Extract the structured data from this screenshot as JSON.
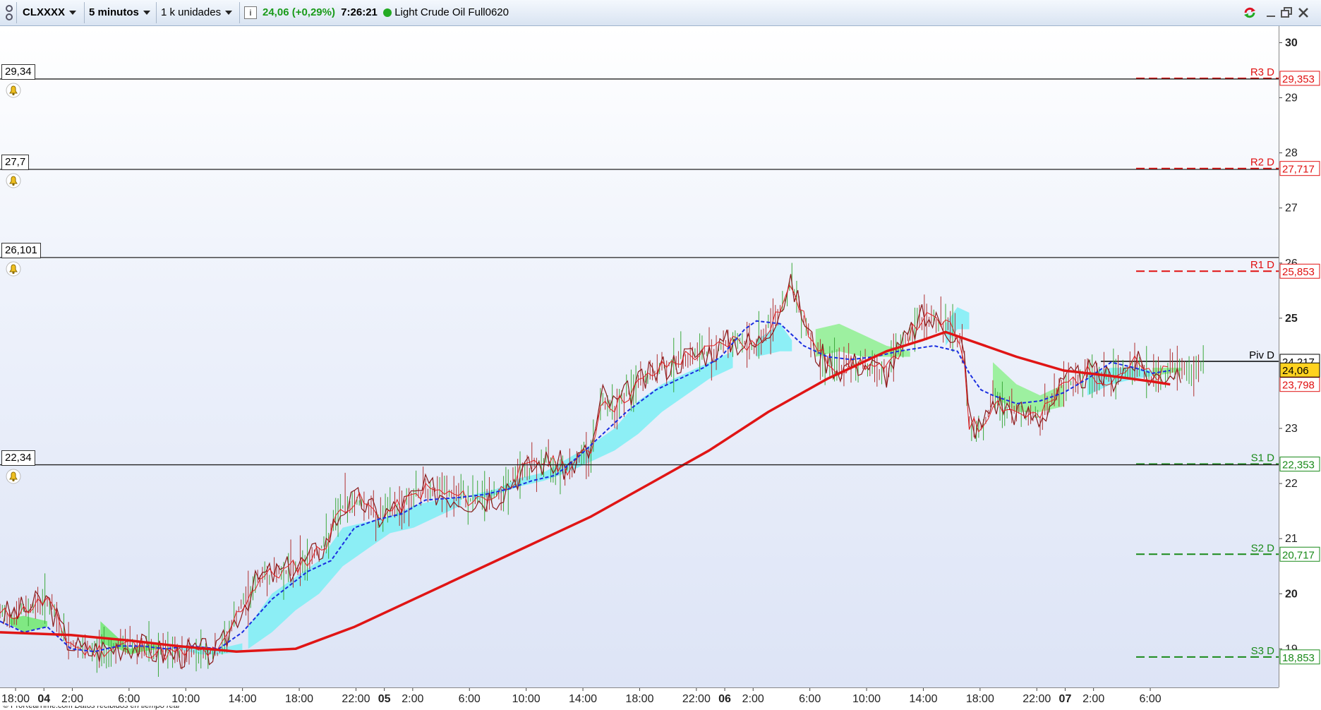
{
  "toolbar": {
    "symbol": "CLXXXX",
    "timeframe": "5 minutos",
    "units": "1 k unidades",
    "info_icon": "info-icon",
    "price": "24,06 (+0,29%)",
    "time": "7:26:21",
    "instrument": "Light Crude Oil Full0620",
    "colors": {
      "positive": "#1a9b1a",
      "status_dot": "#22aa22"
    }
  },
  "window_controls": [
    "refresh-icon",
    "minimize-icon",
    "restore-icon",
    "close-icon"
  ],
  "alerts": [
    {
      "label": "29,34",
      "value": 29.34
    },
    {
      "label": "27,7",
      "value": 27.7
    },
    {
      "label": "26,101",
      "value": 26.101
    },
    {
      "label": "22,34",
      "value": 22.34
    }
  ],
  "pivots": [
    {
      "name": "R3 D",
      "value": 29.353,
      "label": "29,353",
      "color": "#e01010"
    },
    {
      "name": "R2 D",
      "value": 27.717,
      "label": "27,717",
      "color": "#e01010"
    },
    {
      "name": "R1 D",
      "value": 25.853,
      "label": "25,853",
      "color": "#e01010"
    },
    {
      "name": "Piv D",
      "value": 24.217,
      "label": "24,217",
      "color": "#000000"
    },
    {
      "name": "S1 D",
      "value": 22.353,
      "label": "22,353",
      "color": "#1a8a1a"
    },
    {
      "name": "S2 D",
      "value": 20.717,
      "label": "20,717",
      "color": "#1a8a1a"
    },
    {
      "name": "S3 D",
      "value": 18.853,
      "label": "18,853",
      "color": "#1a8a1a"
    }
  ],
  "current_price": {
    "label": "24,06",
    "value": 24.06,
    "color": "#ffd21f"
  },
  "ma_price": {
    "label": "23,798",
    "value": 23.798,
    "color": "#e01010"
  },
  "credit": {
    "source": "© ProRealTime.com",
    "note": "Datos recibidos en tiempo real"
  },
  "chart_data": {
    "type": "line",
    "ylim": [
      18.3,
      30.3
    ],
    "y_ticks": [
      {
        "v": 30,
        "label": "30",
        "bold": true
      },
      {
        "v": 29,
        "label": "29"
      },
      {
        "v": 28,
        "label": "28"
      },
      {
        "v": 27,
        "label": "27"
      },
      {
        "v": 26,
        "label": "26"
      },
      {
        "v": 25,
        "label": "25",
        "bold": true
      },
      {
        "v": 23,
        "label": "23"
      },
      {
        "v": 22,
        "label": "22"
      },
      {
        "v": 21,
        "label": "21"
      },
      {
        "v": 20,
        "label": "20",
        "bold": true
      },
      {
        "v": 19,
        "label": "19"
      }
    ],
    "x_ticks": [
      {
        "i": 6,
        "label": "18:00"
      },
      {
        "i": 30,
        "label": "04",
        "bold": true
      },
      {
        "i": 54,
        "label": "2:00"
      },
      {
        "i": 102,
        "label": "6:00"
      },
      {
        "i": 150,
        "label": "10:00"
      },
      {
        "i": 198,
        "label": "14:00"
      },
      {
        "i": 246,
        "label": "18:00"
      },
      {
        "i": 294,
        "label": "22:00"
      },
      {
        "i": 318,
        "label": "05",
        "bold": true
      },
      {
        "i": 342,
        "label": "2:00"
      },
      {
        "i": 390,
        "label": "6:00"
      },
      {
        "i": 438,
        "label": "10:00"
      },
      {
        "i": 486,
        "label": "14:00"
      },
      {
        "i": 534,
        "label": "18:00"
      },
      {
        "i": 582,
        "label": "22:00"
      },
      {
        "i": 606,
        "label": "06",
        "bold": true
      },
      {
        "i": 630,
        "label": "2:00"
      },
      {
        "i": 678,
        "label": "6:00"
      },
      {
        "i": 726,
        "label": "10:00"
      },
      {
        "i": 774,
        "label": "14:00"
      },
      {
        "i": 822,
        "label": "18:00"
      },
      {
        "i": 870,
        "label": "22:00"
      },
      {
        "i": 894,
        "label": "07",
        "bold": true
      },
      {
        "i": 918,
        "label": "2:00"
      },
      {
        "i": 966,
        "label": "6:00"
      }
    ],
    "bars_count": 1020,
    "price_keypoints": [
      [
        0,
        19.6
      ],
      [
        20,
        19.7
      ],
      [
        40,
        19.9
      ],
      [
        55,
        19.2
      ],
      [
        70,
        18.95
      ],
      [
        90,
        19.0
      ],
      [
        110,
        19.1
      ],
      [
        130,
        18.95
      ],
      [
        150,
        18.9
      ],
      [
        170,
        18.95
      ],
      [
        185,
        18.9
      ],
      [
        200,
        19.6
      ],
      [
        220,
        20.3
      ],
      [
        240,
        20.4
      ],
      [
        260,
        20.6
      ],
      [
        275,
        20.9
      ],
      [
        290,
        21.6
      ],
      [
        305,
        21.7
      ],
      [
        320,
        21.4
      ],
      [
        340,
        21.6
      ],
      [
        360,
        21.9
      ],
      [
        380,
        21.8
      ],
      [
        400,
        21.7
      ],
      [
        420,
        21.8
      ],
      [
        440,
        22.2
      ],
      [
        460,
        22.4
      ],
      [
        480,
        22.3
      ],
      [
        500,
        22.6
      ],
      [
        510,
        23.6
      ],
      [
        520,
        23.4
      ],
      [
        540,
        23.8
      ],
      [
        560,
        24.1
      ],
      [
        580,
        24.3
      ],
      [
        600,
        24.4
      ],
      [
        620,
        24.6
      ],
      [
        640,
        24.5
      ],
      [
        660,
        25.2
      ],
      [
        670,
        25.6
      ],
      [
        690,
        24.4
      ],
      [
        710,
        24.1
      ],
      [
        730,
        24.2
      ],
      [
        750,
        24.0
      ],
      [
        760,
        24.4
      ],
      [
        780,
        25.0
      ],
      [
        800,
        24.9
      ],
      [
        815,
        24.5
      ],
      [
        820,
        23.1
      ],
      [
        830,
        23.0
      ],
      [
        840,
        23.5
      ],
      [
        860,
        23.3
      ],
      [
        880,
        23.2
      ],
      [
        900,
        23.8
      ],
      [
        920,
        24.0
      ],
      [
        940,
        23.9
      ],
      [
        960,
        24.2
      ],
      [
        975,
        23.9
      ],
      [
        990,
        24.06
      ]
    ],
    "ma_keypoints": [
      [
        0,
        19.3
      ],
      [
        60,
        19.25
      ],
      [
        110,
        19.15
      ],
      [
        150,
        19.05
      ],
      [
        200,
        18.95
      ],
      [
        250,
        19.0
      ],
      [
        300,
        19.4
      ],
      [
        350,
        19.9
      ],
      [
        400,
        20.4
      ],
      [
        450,
        20.9
      ],
      [
        500,
        21.4
      ],
      [
        550,
        22.0
      ],
      [
        600,
        22.6
      ],
      [
        650,
        23.3
      ],
      [
        700,
        23.9
      ],
      [
        750,
        24.4
      ],
      [
        780,
        24.6
      ],
      [
        800,
        24.75
      ],
      [
        820,
        24.6
      ],
      [
        860,
        24.3
      ],
      [
        900,
        24.05
      ],
      [
        940,
        23.95
      ],
      [
        975,
        23.85
      ],
      [
        990,
        23.798
      ]
    ],
    "kijun_keypoints": [
      [
        0,
        19.5
      ],
      [
        20,
        19.3
      ],
      [
        40,
        19.4
      ],
      [
        60,
        19.0
      ],
      [
        80,
        18.95
      ],
      [
        100,
        19.05
      ],
      [
        120,
        19.05
      ],
      [
        140,
        19.0
      ],
      [
        160,
        19.05
      ],
      [
        185,
        19.0
      ],
      [
        205,
        19.3
      ],
      [
        230,
        19.9
      ],
      [
        260,
        20.4
      ],
      [
        280,
        20.6
      ],
      [
        300,
        21.2
      ],
      [
        320,
        21.35
      ],
      [
        340,
        21.45
      ],
      [
        360,
        21.7
      ],
      [
        390,
        21.75
      ],
      [
        410,
        21.8
      ],
      [
        430,
        21.9
      ],
      [
        450,
        22.05
      ],
      [
        470,
        22.15
      ],
      [
        490,
        22.5
      ],
      [
        510,
        22.9
      ],
      [
        530,
        23.3
      ],
      [
        555,
        23.7
      ],
      [
        575,
        23.9
      ],
      [
        595,
        24.1
      ],
      [
        610,
        24.3
      ],
      [
        630,
        24.8
      ],
      [
        640,
        24.95
      ],
      [
        660,
        24.9
      ],
      [
        680,
        24.5
      ],
      [
        700,
        24.3
      ],
      [
        720,
        24.25
      ],
      [
        740,
        24.3
      ],
      [
        760,
        24.4
      ],
      [
        790,
        24.5
      ],
      [
        810,
        24.4
      ],
      [
        820,
        24.0
      ],
      [
        830,
        23.7
      ],
      [
        840,
        23.6
      ],
      [
        860,
        23.45
      ],
      [
        880,
        23.5
      ],
      [
        900,
        23.65
      ],
      [
        920,
        23.9
      ],
      [
        940,
        24.2
      ],
      [
        960,
        24.1
      ],
      [
        975,
        24.0
      ],
      [
        990,
        24.05
      ]
    ],
    "cloud_segments": [
      {
        "color": "#6ee86e",
        "points": [
          [
            8,
            19.55,
            19.45
          ],
          [
            20,
            19.6,
            19.3
          ],
          [
            30,
            19.55,
            19.35
          ],
          [
            40,
            19.5,
            19.4
          ]
        ]
      },
      {
        "color": "#6ee86e",
        "points": [
          [
            85,
            19.5,
            19.1
          ],
          [
            100,
            19.2,
            19.0
          ],
          [
            110,
            19.0,
            18.9
          ],
          [
            120,
            19.05,
            18.95
          ],
          [
            135,
            19.1,
            19.0
          ]
        ]
      },
      {
        "color": "#7deef4",
        "points": [
          [
            150,
            19.05,
            19.0
          ],
          [
            170,
            19.0,
            18.9
          ],
          [
            185,
            19.0,
            18.9
          ],
          [
            205,
            19.1,
            18.95
          ]
        ]
      },
      {
        "color": "#7deef4",
        "points": [
          [
            210,
            19.4,
            19.0
          ],
          [
            230,
            20.0,
            19.3
          ],
          [
            250,
            20.3,
            19.7
          ],
          [
            270,
            20.6,
            20.0
          ],
          [
            290,
            21.2,
            20.5
          ],
          [
            310,
            21.3,
            20.8
          ],
          [
            330,
            21.4,
            21.1
          ],
          [
            350,
            21.6,
            21.2
          ],
          [
            370,
            21.7,
            21.4
          ],
          [
            390,
            21.75,
            21.6
          ]
        ]
      },
      {
        "color": "#7deef4",
        "points": [
          [
            400,
            21.8,
            21.7
          ],
          [
            420,
            21.9,
            21.8
          ],
          [
            440,
            22.1,
            21.95
          ],
          [
            460,
            22.2,
            22.05
          ],
          [
            480,
            22.45,
            22.2
          ],
          [
            500,
            22.7,
            22.4
          ],
          [
            520,
            23.0,
            22.6
          ],
          [
            540,
            23.5,
            22.9
          ],
          [
            560,
            23.8,
            23.3
          ],
          [
            580,
            24.0,
            23.6
          ],
          [
            600,
            24.2,
            23.9
          ],
          [
            620,
            24.4,
            24.1
          ]
        ]
      },
      {
        "color": "#7deef4",
        "points": [
          [
            640,
            24.6,
            24.3
          ],
          [
            660,
            24.9,
            24.4
          ],
          [
            670,
            24.6,
            24.4
          ]
        ]
      },
      {
        "color": "#8ff08f",
        "points": [
          [
            690,
            24.8,
            24.3
          ],
          [
            710,
            24.9,
            24.4
          ],
          [
            730,
            24.7,
            24.3
          ],
          [
            750,
            24.5,
            24.3
          ],
          [
            770,
            24.4,
            24.3
          ]
        ]
      },
      {
        "color": "#7deef4",
        "points": [
          [
            800,
            24.9,
            24.5
          ],
          [
            810,
            25.2,
            24.8
          ],
          [
            820,
            25.1,
            24.8
          ]
        ]
      },
      {
        "color": "#8ff08f",
        "points": [
          [
            840,
            24.2,
            23.6
          ],
          [
            860,
            23.8,
            23.3
          ],
          [
            880,
            23.6,
            23.3
          ],
          [
            900,
            23.8,
            23.4
          ]
        ]
      },
      {
        "color": "#7deef4",
        "points": [
          [
            920,
            24.0,
            23.6
          ],
          [
            940,
            24.1,
            23.8
          ],
          [
            960,
            24.1,
            23.9
          ],
          [
            975,
            24.05,
            23.95
          ]
        ]
      },
      {
        "color": "#8ff08f",
        "points": [
          [
            975,
            24.1,
            23.95
          ],
          [
            990,
            24.1,
            24.0
          ],
          [
            1000,
            24.1,
            24.05
          ]
        ]
      }
    ]
  }
}
